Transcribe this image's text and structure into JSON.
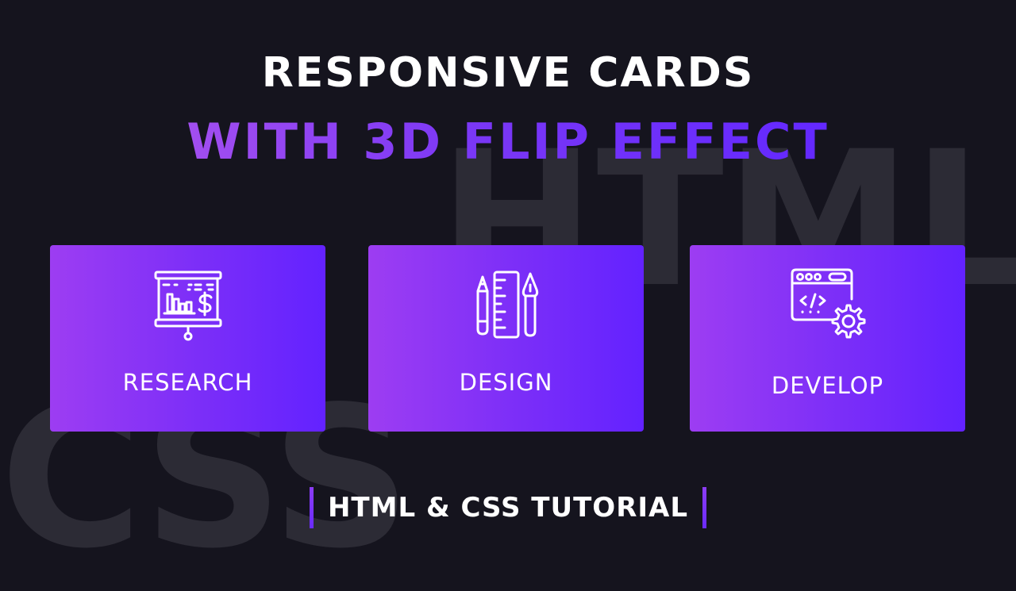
{
  "background": {
    "color": "#15141e",
    "watermark_words": [
      "HTML",
      "CSS"
    ],
    "watermark_color": "#2c2b35"
  },
  "heading": {
    "line1": "RESPONSIVE CARDS",
    "line2": "WITH 3D FLIP EFFECT",
    "line2_gradient": [
      "#a24ef0",
      "#6328ff"
    ]
  },
  "cards": [
    {
      "icon": "presentation-chart-dollar-icon",
      "label": "RESEARCH"
    },
    {
      "icon": "pencil-ruler-pen-icon",
      "label": "DESIGN"
    },
    {
      "icon": "code-window-gear-icon",
      "label": "DEVELOP"
    }
  ],
  "card_gradient": [
    "#9d3df2",
    "#6322ff"
  ],
  "footer": {
    "text": "HTML & CSS TUTORIAL",
    "accent": "#7b35f8"
  }
}
